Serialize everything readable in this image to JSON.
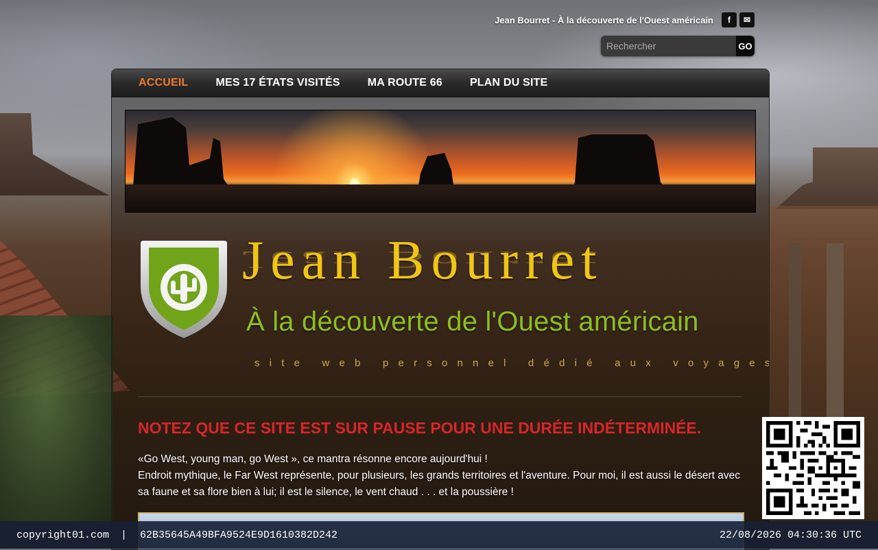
{
  "header": {
    "site_tagline": "Jean Bourret - À la découverte de l'Ouest américain",
    "social": [
      {
        "icon": "facebook-icon",
        "glyph": "f"
      },
      {
        "icon": "mail-icon",
        "glyph": "✉"
      }
    ],
    "search": {
      "placeholder": "Rechercher",
      "button_label": "GO"
    }
  },
  "nav": {
    "items": [
      {
        "label": "ACCUEIL",
        "active": true
      },
      {
        "label": "MES 17 ÉTATS VISITÉS",
        "active": false
      },
      {
        "label": "MA ROUTE 66",
        "active": false
      },
      {
        "label": "PLAN DU SITE",
        "active": false
      }
    ]
  },
  "hero": {
    "title": "Jean Bourret",
    "subtitle": "À la découverte de l'Ouest américain",
    "tagline": "site web personnel dédié aux voyages"
  },
  "content": {
    "notice": "NOTEZ QUE CE SITE EST SUR PAUSE POUR UNE DURÉE INDÉTERMINÉE.",
    "intro_line1": "«Go West, young man, go West », ce mantra résonne encore aujourd'hui !",
    "intro_line2": "Endroit mythique, le Far West représente, pour plusieurs, les grands territoires et l'aventure. Pour moi, il est aussi le désert avec sa faune et sa flore bien à lui; il est le silence, le vent chaud . . .    et la poussière !"
  },
  "footer": {
    "copyright": "copyright01.com",
    "separator": "|",
    "hash": "62B35645A49BFA9524E9D1610382D242",
    "timestamp": "22/08/2026 04:30:36 UTC"
  },
  "colors": {
    "nav_active": "#f07a2a",
    "title_gold": "#f1c514",
    "subtitle_green": "#8dbf1e",
    "notice_red": "#d8262a",
    "footer_bg": "#162034"
  }
}
